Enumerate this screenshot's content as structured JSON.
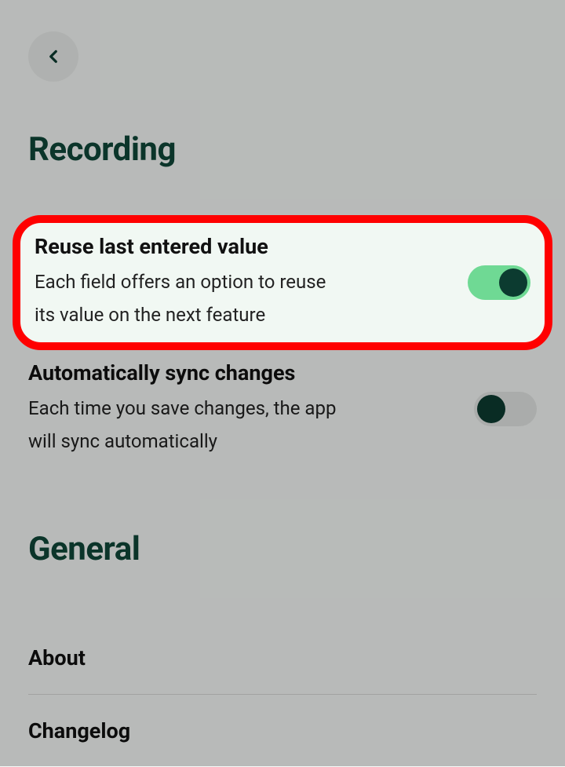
{
  "sections": {
    "recording": {
      "title": "Recording",
      "settings": [
        {
          "label": "Reuse last entered value",
          "description": "Each field offers an option to reuse its value on the next feature",
          "toggle": true
        },
        {
          "label": "Automatically sync changes",
          "description": "Each time you save changes, the app will sync automatically",
          "toggle": false
        }
      ]
    },
    "general": {
      "title": "General",
      "items": [
        {
          "label": "About"
        },
        {
          "label": "Changelog"
        }
      ]
    }
  }
}
